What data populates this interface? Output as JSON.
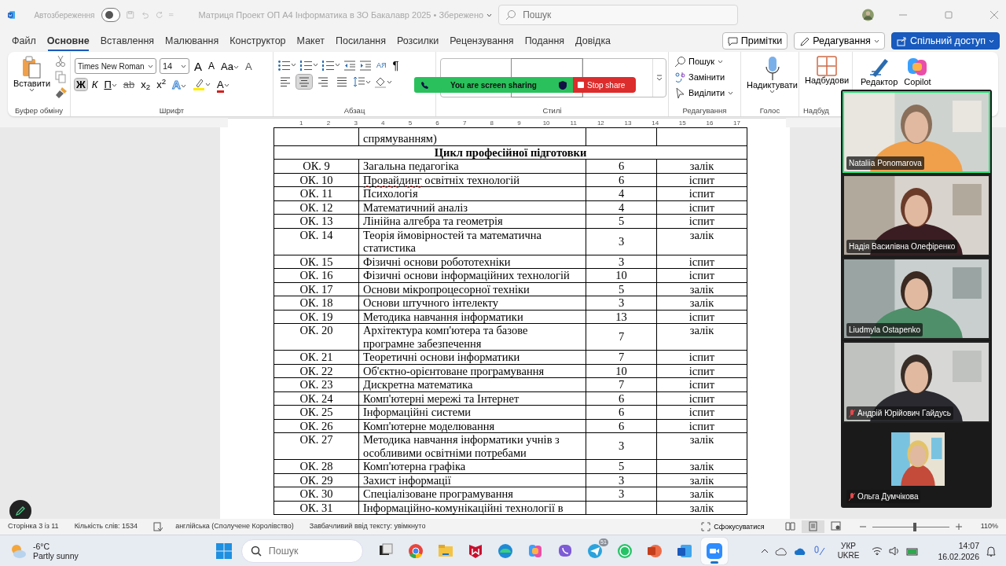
{
  "titlebar": {
    "autosave": {
      "label": "Автозбереження",
      "on": false
    },
    "title": "Матриця Проект ОП А4 Інформатика в ЗО Бакалавр 2025 • Збережено",
    "search": {
      "placeholder": "Пошук"
    }
  },
  "tabs": [
    {
      "label": "Файл",
      "selected": false
    },
    {
      "label": "Основне",
      "selected": true
    },
    {
      "label": "Вставлення",
      "selected": false
    },
    {
      "label": "Малювання",
      "selected": false
    },
    {
      "label": "Конструктор",
      "selected": false
    },
    {
      "label": "Макет",
      "selected": false
    },
    {
      "label": "Посилання",
      "selected": false
    },
    {
      "label": "Розсилки",
      "selected": false
    },
    {
      "label": "Рецензування",
      "selected": false
    },
    {
      "label": "Подання",
      "selected": false
    },
    {
      "label": "Довідка",
      "selected": false
    }
  ],
  "actions": [
    {
      "kind": "comments",
      "label": "Примітки"
    },
    {
      "kind": "editing",
      "label": "Редагування"
    },
    {
      "kind": "share",
      "label": "Спільний доступ"
    }
  ],
  "ribbon": {
    "clipboard": {
      "label": "Буфер обміну",
      "paste": "Вставити"
    },
    "font": {
      "label": "Шрифт",
      "family": "Times New Roman",
      "size": "14",
      "tools": [
        {
          "kind": "grow",
          "label": "A",
          "selected": false
        },
        {
          "kind": "shrink",
          "label": "A",
          "selected": false
        },
        {
          "kind": "case",
          "label": "Aa",
          "selected": false
        },
        {
          "kind": "clear",
          "label": "A",
          "selected": false
        }
      ],
      "styles": [
        {
          "kind": "bold",
          "label": "Ж",
          "selected": true
        },
        {
          "kind": "italic",
          "label": "К",
          "selected": false
        },
        {
          "kind": "underline",
          "label": "П",
          "selected": false
        },
        {
          "kind": "strike",
          "label": "ab",
          "selected": false
        },
        {
          "kind": "sub",
          "label": "x$_{2}$",
          "selected": false
        },
        {
          "kind": "sup",
          "label": "x$^{2}$",
          "selected": false
        },
        {
          "kind": "effects",
          "label": "A",
          "selected": false
        },
        {
          "kind": "highlight",
          "selected": false
        },
        {
          "kind": "color",
          "label": "A",
          "selected": false
        }
      ]
    },
    "paragraph": {
      "label": "Абзац",
      "sort": "АЯ",
      "pilcrow": "¶",
      "align": [
        {
          "kind": "left",
          "selected": false
        },
        {
          "kind": "center",
          "selected": true
        },
        {
          "kind": "right",
          "selected": false
        },
        {
          "kind": "justify",
          "selected": false
        }
      ]
    },
    "styles": {
      "label": "Стилі"
    },
    "editing": {
      "label": "Редагування",
      "items": [
        {
          "kind": "find",
          "label": "Пошук"
        },
        {
          "kind": "replace",
          "label": "Замінити"
        },
        {
          "kind": "select",
          "label": "Виділити"
        }
      ]
    },
    "voice": {
      "label": "Голос",
      "button": "Надиктувати"
    },
    "addins": {
      "label": "Надбуд",
      "button": "Надбудови"
    },
    "extra": [
      {
        "kind": "editor",
        "label": "Редактор"
      },
      {
        "kind": "copilot",
        "label": "Copilot"
      }
    ]
  },
  "share_bar": {
    "status": "You are screen sharing",
    "stop": "Stop share"
  },
  "ruler": [
    "1",
    "2",
    "3",
    "4",
    "5",
    "6",
    "7",
    "8",
    "9",
    "10",
    "11",
    "12",
    "13",
    "14",
    "15",
    "16",
    "17"
  ],
  "table": {
    "rows": [
      {
        "kind": "partial",
        "name": "спрямуванням)"
      },
      {
        "kind": "section",
        "name": "Цикл професійної підготовки"
      },
      {
        "kind": "course",
        "code": "ОК. 9",
        "name": "Загальна педагогіка",
        "credits": "6",
        "control": "залік"
      },
      {
        "kind": "course",
        "code": "ОК. 10",
        "name": "Провайдинг освітніх технологій",
        "credits": "6",
        "control": "іспит",
        "spelling_flag": true
      },
      {
        "kind": "course",
        "code": "ОК. 11",
        "name": "Психологія",
        "credits": "4",
        "control": "іспит"
      },
      {
        "kind": "course",
        "code": "ОК. 12",
        "name": "Математичний аналіз",
        "credits": "4",
        "control": "іспит"
      },
      {
        "kind": "course",
        "code": "ОК. 13",
        "name": "Лінійна алгебра та геометрія",
        "credits": "5",
        "control": "іспит"
      },
      {
        "kind": "course",
        "code": "ОК. 14",
        "name": "Теорія ймовірностей та математична статистика",
        "credits": "3",
        "control": "залік"
      },
      {
        "kind": "course",
        "code": "ОК. 15",
        "name": "Фізичні основи робототехніки",
        "credits": "3",
        "control": "іспит"
      },
      {
        "kind": "course",
        "code": "ОК. 16",
        "name": "Фізичні основи інформаційних технологій",
        "credits": "10",
        "control": "іспит"
      },
      {
        "kind": "course",
        "code": "ОК. 17",
        "name": "Основи мікропроцесорної техніки",
        "credits": "5",
        "control": "залік"
      },
      {
        "kind": "course",
        "code": "ОК. 18",
        "name": "Основи штучного інтелекту",
        "credits": "3",
        "control": "залік"
      },
      {
        "kind": "course",
        "code": "ОК. 19",
        "name": "Методика навчання інформатики",
        "credits": "13",
        "control": "іспит"
      },
      {
        "kind": "course",
        "code": "ОК. 20",
        "name": "Архітектура комп'ютера та базове програмне забезпечення",
        "credits": "7",
        "control": "залік"
      },
      {
        "kind": "course",
        "code": "ОК. 21",
        "name": "Теоретичні основи інформатики",
        "credits": "7",
        "control": "іспит"
      },
      {
        "kind": "course",
        "code": "ОК. 22",
        "name": "Об'єктно-орієнтоване програмування",
        "credits": "10",
        "control": "іспит"
      },
      {
        "kind": "course",
        "code": "ОК. 23",
        "name": "Дискретна математика",
        "credits": "7",
        "control": "іспит"
      },
      {
        "kind": "course",
        "code": "ОК. 24",
        "name": "Комп'ютерні мережі та Інтернет",
        "credits": "6",
        "control": "іспит"
      },
      {
        "kind": "course",
        "code": "ОК. 25",
        "name": "Інформаційні системи",
        "credits": "6",
        "control": "іспит"
      },
      {
        "kind": "course",
        "code": "ОК. 26",
        "name": "Комп'ютерне моделювання",
        "credits": "6",
        "control": "іспит"
      },
      {
        "kind": "course",
        "code": "ОК. 27",
        "name": "Методика навчання інформатики учнів з особливими освітніми потребами",
        "credits": "3",
        "control": "залік"
      },
      {
        "kind": "course",
        "code": "ОК. 28",
        "name": "Комп'ютерна графіка",
        "credits": "5",
        "control": "залік"
      },
      {
        "kind": "course",
        "code": "ОК. 29",
        "name": "Захист інформації",
        "credits": "3",
        "control": "залік"
      },
      {
        "kind": "course",
        "code": "ОК. 30",
        "name": "Спеціалізоване програмування",
        "credits": "3",
        "control": "залік"
      },
      {
        "kind": "course",
        "code": "ОК. 31",
        "name": "Інформаційно-комунікаційні технології в",
        "control": "залік"
      }
    ]
  },
  "participants": [
    {
      "name": "Nataliia Ponomarova",
      "speaking": true,
      "muted": false,
      "kind": "video"
    },
    {
      "name": "Надія Василівна Олефіренко",
      "speaking": false,
      "muted": false,
      "kind": "video"
    },
    {
      "name": "Liudmyla Ostapenko",
      "speaking": false,
      "muted": false,
      "kind": "video"
    },
    {
      "name": "Андрій Юрійович Гайдусь",
      "speaking": false,
      "muted": true,
      "kind": "video"
    },
    {
      "name": "Ольга Думчікова",
      "speaking": false,
      "muted": true,
      "kind": "thumbnail"
    }
  ],
  "status_bar": {
    "page": "Сторінка 3 із 11",
    "words": "Кількість слів: 1534",
    "language": "англійська (Сполучене Королівство)",
    "prediction": "Завбачливий ввід тексту: увімкнуто",
    "focus": "Сфокусуватися",
    "views": [
      {
        "kind": "read",
        "selected": false
      },
      {
        "kind": "print",
        "selected": true
      },
      {
        "kind": "web",
        "selected": false
      }
    ],
    "zoom": {
      "level": 0.55,
      "reading": "110%"
    }
  },
  "taskbar": {
    "weather": {
      "temperature": "-6°C",
      "condition": "Partly sunny"
    },
    "search": {
      "placeholder": "Пошук"
    },
    "apps": [
      {
        "kind": "taskview",
        "active": false
      },
      {
        "kind": "chrome",
        "active": false
      },
      {
        "kind": "explorer",
        "active": false
      },
      {
        "kind": "mcafee",
        "active": false
      },
      {
        "kind": "edge",
        "active": false
      },
      {
        "kind": "copilot",
        "active": false
      },
      {
        "kind": "viber",
        "active": false
      },
      {
        "kind": "telegram",
        "active": false,
        "badge": "51"
      },
      {
        "kind": "whatsapp",
        "active": false
      },
      {
        "kind": "powerpoint",
        "active": false
      },
      {
        "kind": "word",
        "active": false
      },
      {
        "kind": "zoom",
        "active": true
      }
    ],
    "language": [
      "УКР",
      "UKRE"
    ],
    "time": "14:07",
    "date": "16.02.2026"
  }
}
